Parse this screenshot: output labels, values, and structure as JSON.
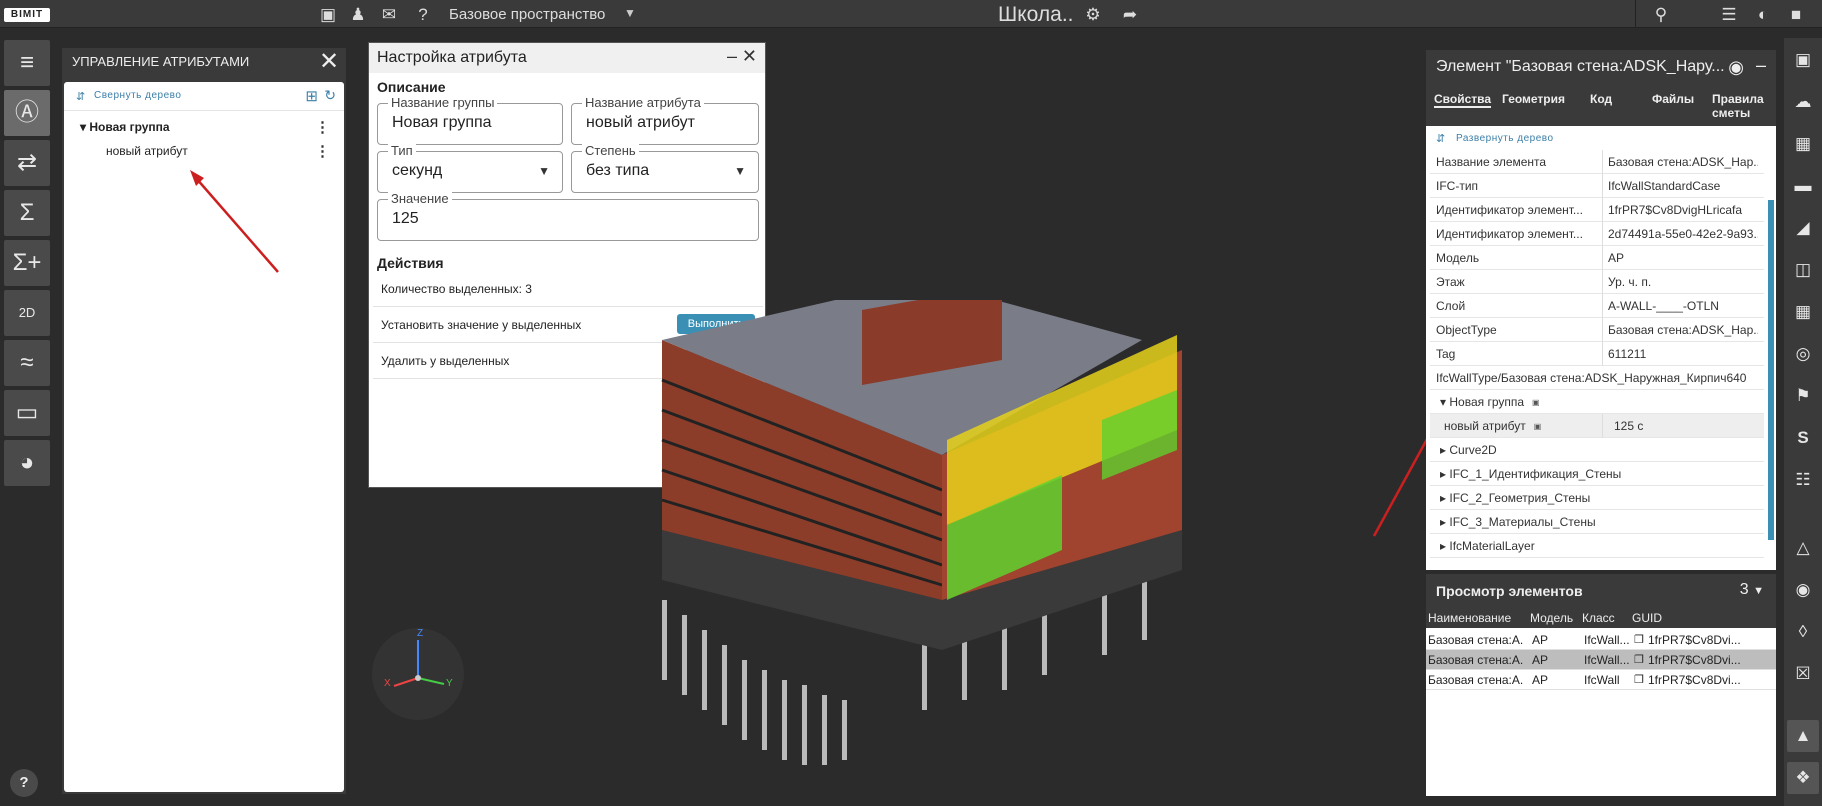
{
  "topbar": {
    "logo": "BIMIT",
    "space": "Базовое пространство",
    "project": "Школа..",
    "icons": [
      "briefcase-icon",
      "users-icon",
      "chat-icon",
      "help-circle-icon",
      "gear-icon",
      "share-icon",
      "search-icon",
      "list-icon",
      "notification-icon",
      "user-icon"
    ]
  },
  "left_tools": [
    "tree-icon",
    "attribute-icon",
    "shuffle-icon",
    "sum-icon",
    "sum-plus-icon",
    "2d-icon",
    "chart-icon",
    "folder-icon",
    "gauge-icon"
  ],
  "left_tools_labels": {
    "twod": "2D"
  },
  "attr_panel": {
    "title": "УПРАВЛЕНИЕ АТРИБУТАМИ",
    "collapse": "Свернуть дерево",
    "group": "Новая группа",
    "attribute": "новый атрибут"
  },
  "dialog": {
    "title": "Настройка атрибута",
    "description": "Описание",
    "group_label": "Название группы",
    "group_value": "Новая группа",
    "attr_label": "Название атрибута",
    "attr_value": "новый атрибут",
    "type_label": "Тип",
    "type_value": "секунд",
    "degree_label": "Степень",
    "degree_value": "без типа",
    "value_label": "Значение",
    "value_value": "125",
    "actions": "Действия",
    "selected_count": "Количество выделенных: 3",
    "set_value": "Установить значение у выделенных",
    "delete": "Удалить у выделенных",
    "run": "Выполнить"
  },
  "viewport": {
    "axes": {
      "x": "X",
      "y": "Y",
      "z": "Z"
    }
  },
  "props": {
    "title": "Элемент \"Базовая стена:ADSK_Нару...",
    "tabs": [
      "Свойства",
      "Геометрия",
      "Код",
      "Файлы",
      "Правила сметы"
    ],
    "expand": "Развернуть дерево",
    "rows": [
      {
        "name": "Название элемента",
        "value": "Базовая стена:ADSK_Нар..."
      },
      {
        "name": "IFC-тип",
        "value": "IfcWallStandardCase"
      },
      {
        "name": "Идентификатор элемент...",
        "value": "1frPR7$Cv8DvigHLricafa"
      },
      {
        "name": "Идентификатор элемент...",
        "value": "2d74491a-55e0-42e2-9a93..."
      },
      {
        "name": "Модель",
        "value": "АР"
      },
      {
        "name": "Этаж",
        "value": "Ур. ч. п."
      },
      {
        "name": "Слой",
        "value": "A-WALL-____-OTLN"
      },
      {
        "name": "ObjectType",
        "value": "Базовая стена:ADSK_Нар..."
      },
      {
        "name": "Tag",
        "value": "611211"
      }
    ],
    "type_row": "IfcWallType/Базовая стена:ADSK_Наружная_Кирпич640",
    "group": "Новая группа",
    "attr_name": "новый атрибут",
    "attr_value": "125 с",
    "groups": [
      "Curve2D",
      "IFC_1_Идентификация_Стены",
      "IFC_2_Геометрия_Стены",
      "IFC_3_Материалы_Стены",
      "IfcMaterialLayer"
    ]
  },
  "elements": {
    "title": "Просмотр элементов",
    "count": "3",
    "columns": [
      "Наименование",
      "Модель",
      "Класс",
      "GUID"
    ],
    "rows": [
      {
        "name": "Базовая стена:А...",
        "model": "АР",
        "class": "IfcWall...",
        "guid": "1frPR7$Cv8Dvi..."
      },
      {
        "name": "Базовая стена:А...",
        "model": "АР",
        "class": "IfcWall...",
        "guid": "1frPR7$Cv8Dvi..."
      },
      {
        "name": "Базовая стена:А...",
        "model": "АР",
        "class": "IfcWall",
        "guid": "1frPR7$Cv8Dvi..."
      }
    ]
  },
  "right_tools": [
    "fit-view-icon",
    "cloud-icon",
    "select-icon",
    "ruler-icon",
    "section-icon",
    "box-icon",
    "grid-icon",
    "target-icon",
    "flag-icon",
    "s-icon",
    "grid-cross-icon",
    "cube-outline-icon",
    "eye-icon",
    "eye-off-icon",
    "close-box-icon",
    "cube-icon",
    "orbit-icon"
  ]
}
